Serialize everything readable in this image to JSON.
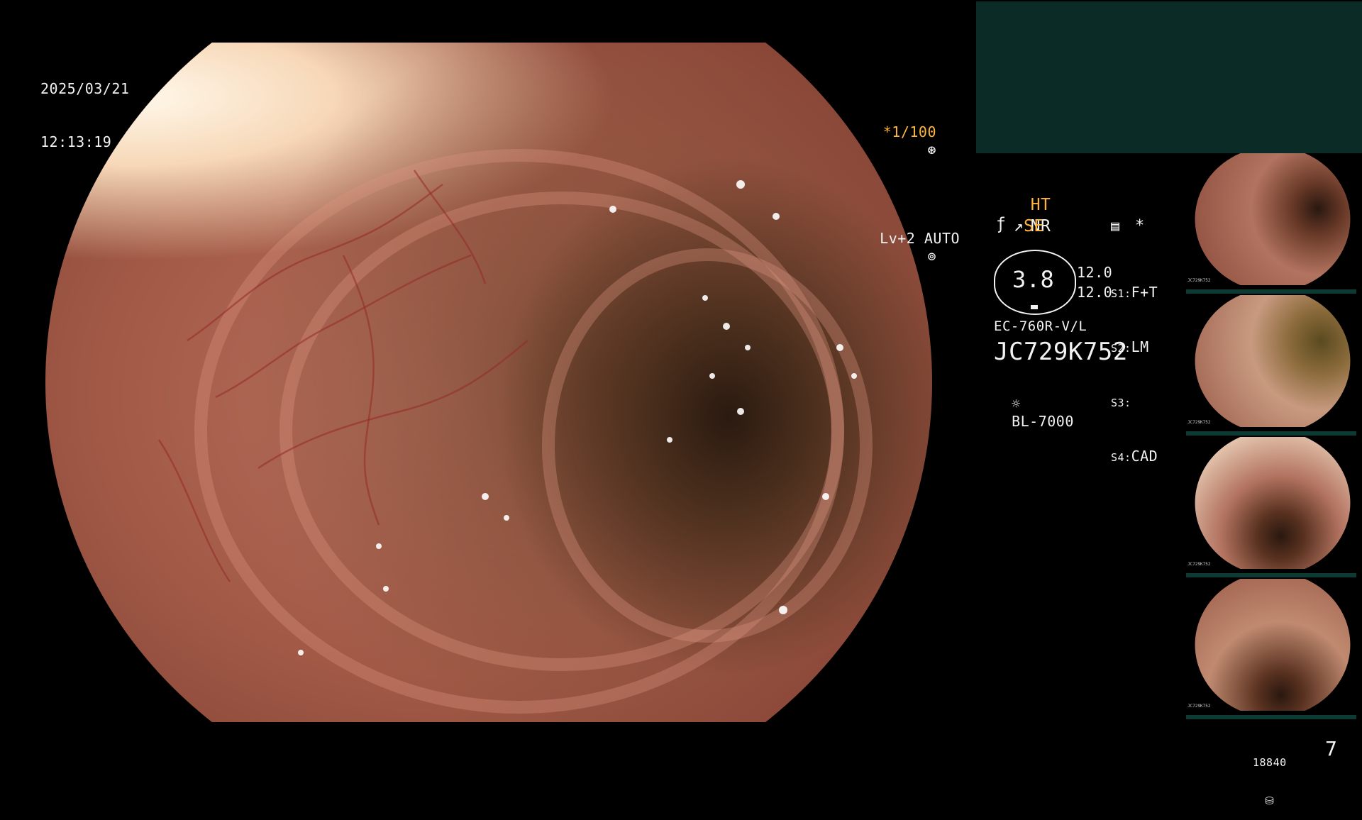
{
  "header": {
    "date": "2025/03/21",
    "time": "12:13:19",
    "shutter": "*1/100",
    "level_mode": "Lv+2 AUTO"
  },
  "status": {
    "ht": "HT",
    "nr": "NR",
    "se": "SE",
    "star": "*",
    "dial_value": "3.8",
    "side_value_1": "12.0",
    "side_value_2": "12.0",
    "s1_label": "S1:",
    "s1_value": "F+T",
    "s2_label": "S2:",
    "s2_value": "LM",
    "s3_label": "S3:",
    "s3_value": "",
    "s4_label": "S4:",
    "s4_value": "CAD",
    "scope_model": "EC-760R-V/L",
    "scope_serial": "JC729K752",
    "light_source": "BL-7000"
  },
  "footer": {
    "storage_count": "18840",
    "image_count": "7"
  },
  "thumbnails": [
    {
      "serial": "JC729K752"
    },
    {
      "serial": "JC729K752"
    },
    {
      "serial": "JC729K752"
    },
    {
      "serial": "JC729K752"
    }
  ],
  "colors": {
    "accent_yellow": "#ffb43c",
    "panel_green": "#0b2b26",
    "text": "#f2f2f2"
  }
}
